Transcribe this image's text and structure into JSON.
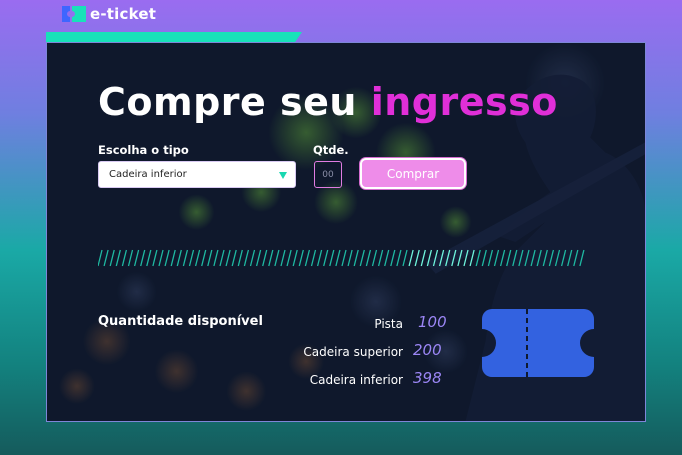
{
  "brand": {
    "name": "e-ticket",
    "logo_icon": "ticket-logo-icon"
  },
  "hero": {
    "title_part1": "Compre seu ",
    "title_highlight": "ingresso"
  },
  "form": {
    "type_label": "Escolha o tipo",
    "type_selected": "Cadeira inferior",
    "qty_label": "Qtde.",
    "qty_placeholder": "00",
    "buy_label": "Comprar"
  },
  "availability": {
    "title": "Quantidade disponível",
    "items": [
      {
        "label": "Pista",
        "count": "100"
      },
      {
        "label": "Cadeira superior",
        "count": "200"
      },
      {
        "label": "Cadeira inferior",
        "count": "398"
      }
    ]
  },
  "colors": {
    "accent_pink": "#e02fd8",
    "accent_teal": "#18e2b9",
    "ticket_blue": "#3362e0",
    "count_purple": "#9b86f5"
  }
}
